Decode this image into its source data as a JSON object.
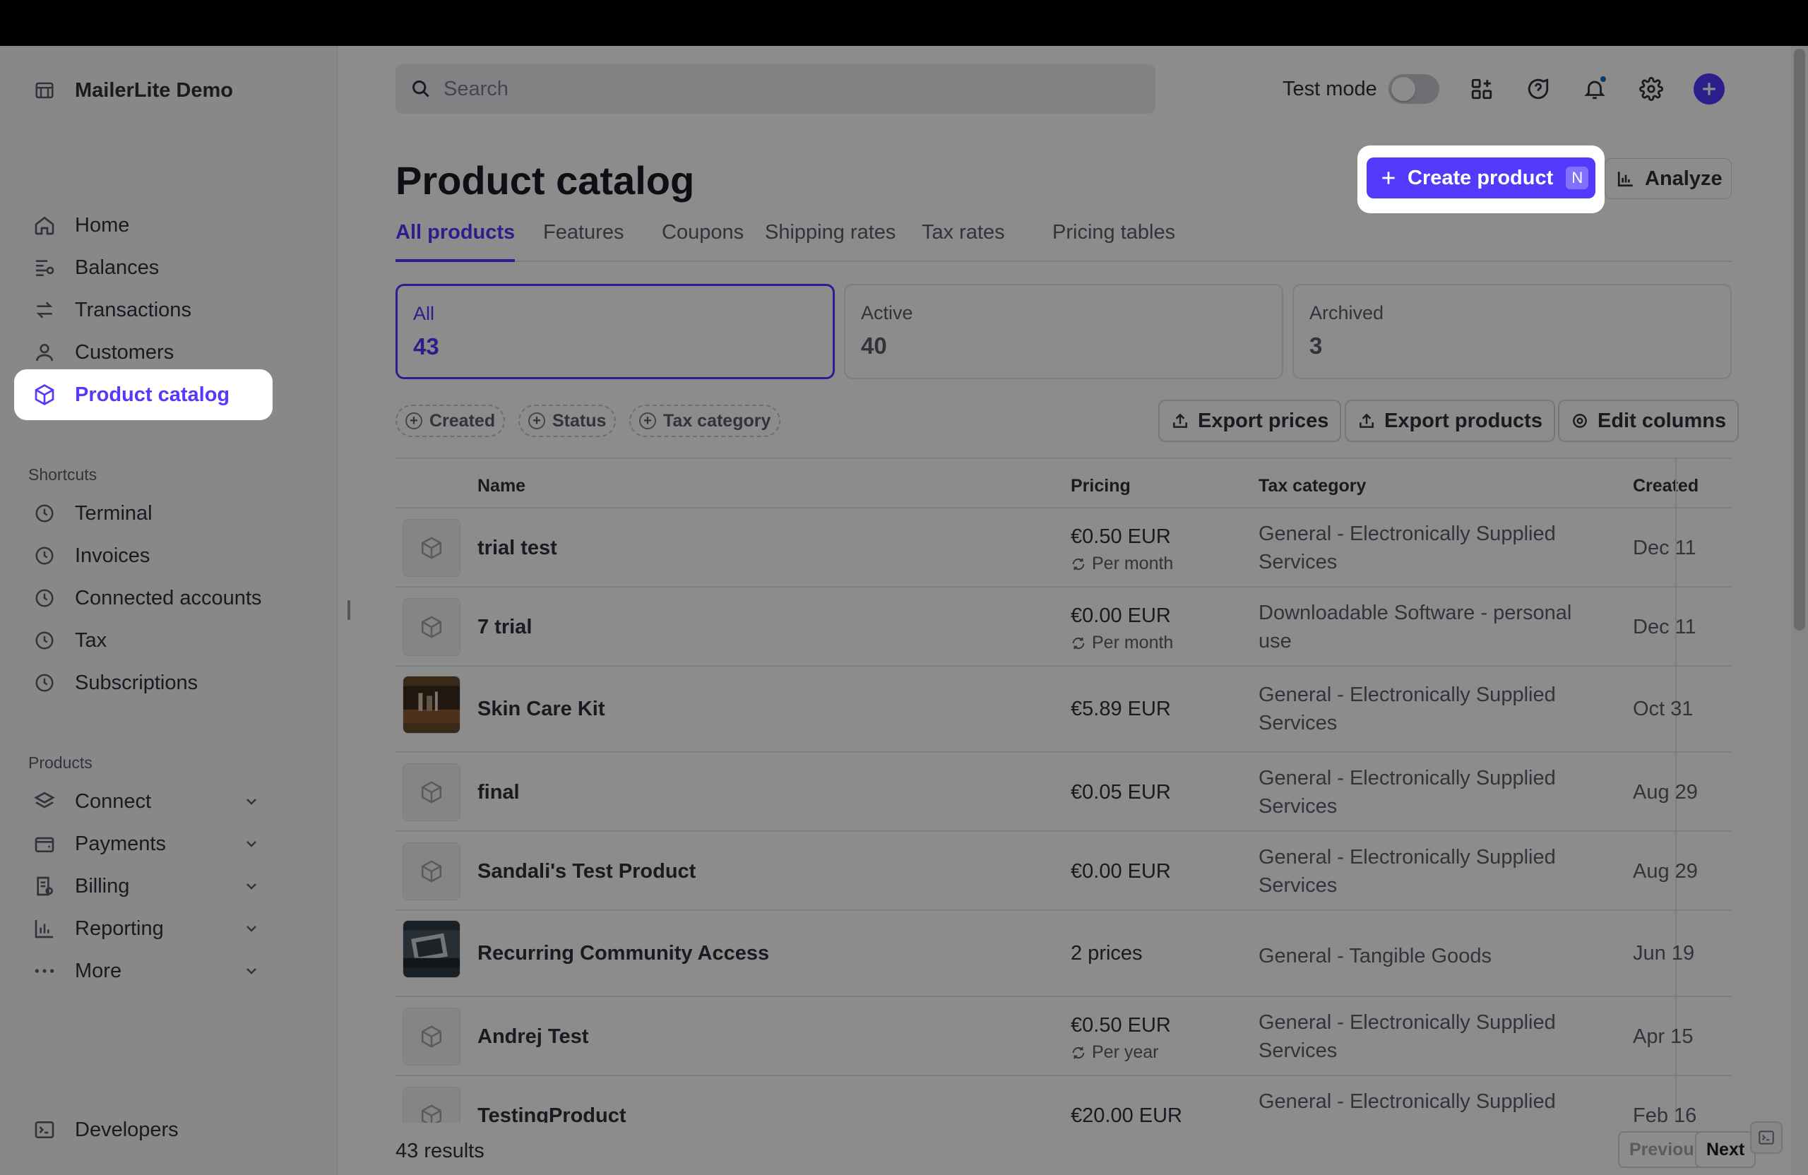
{
  "sidebar": {
    "account_name": "MailerLite Demo",
    "nav": [
      {
        "label": "Home",
        "icon": "home-icon"
      },
      {
        "label": "Balances",
        "icon": "balances-icon"
      },
      {
        "label": "Transactions",
        "icon": "transactions-icon"
      },
      {
        "label": "Customers",
        "icon": "customers-icon"
      },
      {
        "label": "Product catalog",
        "icon": "product-catalog-icon",
        "active": true
      }
    ],
    "shortcuts_label": "Shortcuts",
    "shortcuts": [
      {
        "label": "Terminal",
        "icon": "clock-icon"
      },
      {
        "label": "Invoices",
        "icon": "clock-icon"
      },
      {
        "label": "Connected accounts",
        "icon": "clock-icon"
      },
      {
        "label": "Tax",
        "icon": "clock-icon"
      },
      {
        "label": "Subscriptions",
        "icon": "clock-icon"
      }
    ],
    "products_label": "Products",
    "products": [
      {
        "label": "Connect",
        "icon": "connect-icon"
      },
      {
        "label": "Payments",
        "icon": "wallet-icon"
      },
      {
        "label": "Billing",
        "icon": "billing-icon"
      },
      {
        "label": "Reporting",
        "icon": "reporting-icon"
      },
      {
        "label": "More",
        "icon": "more-dots-icon"
      }
    ],
    "developers_label": "Developers"
  },
  "topbar": {
    "search_placeholder": "Search",
    "test_mode_label": "Test mode",
    "test_mode_on": false
  },
  "page": {
    "title": "Product catalog",
    "create_label": "Create product",
    "create_shortcut": "N",
    "analyze_label": "Analyze",
    "tabs": [
      "All products",
      "Features",
      "Coupons",
      "Shipping rates",
      "Tax rates",
      "Pricing tables"
    ],
    "active_tab": "All products",
    "summary": [
      {
        "label": "All",
        "count": "43"
      },
      {
        "label": "Active",
        "count": "40"
      },
      {
        "label": "Archived",
        "count": "3"
      }
    ],
    "filters": [
      "Created",
      "Status",
      "Tax category"
    ],
    "actions": {
      "export_prices": "Export prices",
      "export_products": "Export products",
      "edit_columns": "Edit columns"
    }
  },
  "table": {
    "columns": {
      "name": "Name",
      "pricing": "Pricing",
      "tax": "Tax category",
      "created": "Created"
    },
    "rows": [
      {
        "name": "trial test",
        "price": "€0.50 EUR",
        "interval": "Per month",
        "tax": "General - Electronically Supplied Services",
        "created": "Dec 11"
      },
      {
        "name": "7 trial",
        "price": "€0.00 EUR",
        "interval": "Per month",
        "tax": "Downloadable Software - personal use",
        "created": "Dec 11"
      },
      {
        "name": "Skin Care Kit",
        "price": "€5.89 EUR",
        "interval": "",
        "tax": "General - Electronically Supplied Services",
        "created": "Oct 31"
      },
      {
        "name": "final",
        "price": "€0.05 EUR",
        "interval": "",
        "tax": "General - Electronically Supplied Services",
        "created": "Aug 29"
      },
      {
        "name": "Sandali's Test Product",
        "price": "€0.00 EUR",
        "interval": "",
        "tax": "General - Electronically Supplied Services",
        "created": "Aug 29"
      },
      {
        "name": "Recurring Community Access",
        "price": "2 prices",
        "interval": "",
        "tax": "General - Tangible Goods",
        "created": "Jun 19"
      },
      {
        "name": "Andrej Test",
        "price": "€0.50 EUR",
        "interval": "Per year",
        "tax": "General - Electronically Supplied Services",
        "created": "Apr 15"
      },
      {
        "name": "TestingProduct",
        "price": "€20.00 EUR",
        "interval": "",
        "tax": "General - Electronically Supplied",
        "created": "Feb 16"
      }
    ]
  },
  "footer": {
    "results": "43 results",
    "previous": "Previous",
    "next": "Next"
  },
  "colors": {
    "accent": "#533afd",
    "overlay": "rgba(0,0,0,0.45)"
  }
}
